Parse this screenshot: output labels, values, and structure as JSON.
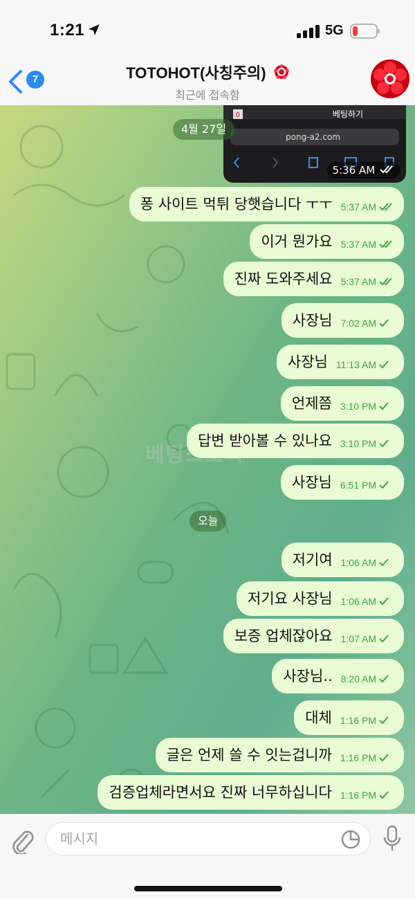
{
  "status_bar": {
    "time": "1:21",
    "network": "5G"
  },
  "header": {
    "back_badge": "7",
    "title": "TOTOHOT(사칭주의)",
    "subtitle": "최근에 접속함"
  },
  "shared_screenshot": {
    "bet_button": "베팅하기",
    "url": "pong-a2.com",
    "caa": "가가",
    "time": "5:36 AM"
  },
  "date_pills": {
    "first": "4월 27일",
    "second": "오늘"
  },
  "messages": [
    {
      "text": "퐁 사이트 먹튀 당햇습니다 ㅜㅜ",
      "time": "5:37 AM",
      "read": true
    },
    {
      "text": "이거 뭔가요",
      "time": "5:37 AM",
      "read": true
    },
    {
      "text": "진짜 도와주세요",
      "time": "5:37 AM",
      "read": true
    },
    {
      "text": "사장님",
      "time": "7:02 AM",
      "read": false
    },
    {
      "text": "사장님",
      "time": "11:13 AM",
      "read": false
    },
    {
      "text": "언제쯤",
      "time": "3:10 PM",
      "read": false
    },
    {
      "text": "답변 받아볼 수 있나요",
      "time": "3:10 PM",
      "read": false
    },
    {
      "text": "사장님",
      "time": "6:51 PM",
      "read": false
    },
    {
      "text": "저기여",
      "time": "1:06 AM",
      "read": false
    },
    {
      "text": "저기요 사장님",
      "time": "1:06 AM",
      "read": false
    },
    {
      "text": "보증 업체잖아요",
      "time": "1:07 AM",
      "read": false
    },
    {
      "text": "사장님..",
      "time": "8:20 AM",
      "read": false
    },
    {
      "text": "대체",
      "time": "1:16 PM",
      "read": false
    },
    {
      "text": "글은 언제 쓸 수 잇는겁니까",
      "time": "1:16 PM",
      "read": false
    },
    {
      "text": "검증업체라면서요 진짜 너무하십니다",
      "time": "1:16 PM",
      "read": false
    }
  ],
  "watermark": "베팅스토리",
  "input": {
    "placeholder": "메시지"
  },
  "colors": {
    "bubble_bg": "#e9fcd4",
    "time_green": "#3aa442",
    "accent_blue": "#2a8af6",
    "badge_red": "#c40010"
  }
}
